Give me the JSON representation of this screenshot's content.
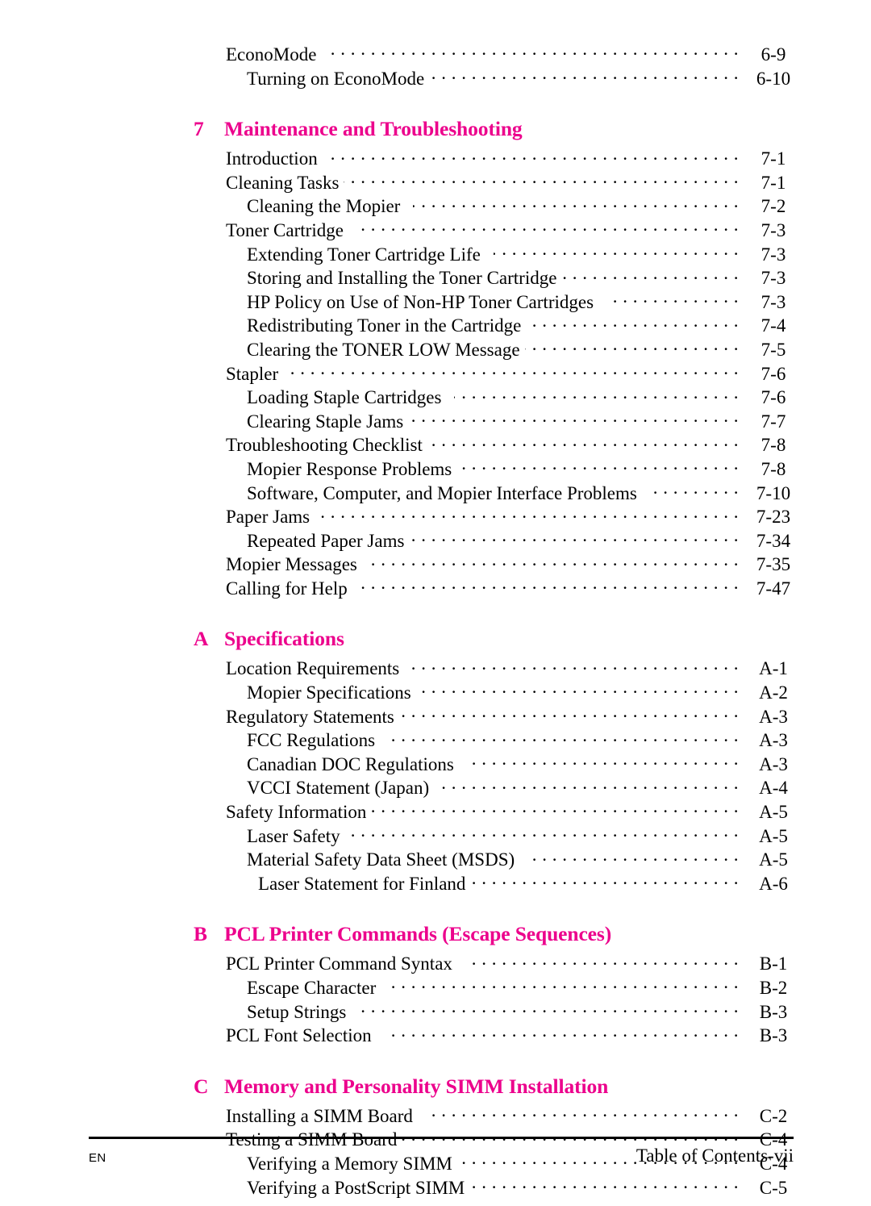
{
  "document": {
    "type": "table-of-contents",
    "accent_color": "#EC008C",
    "text_color": "#000000",
    "background_color": "#FFFFFF"
  },
  "blocks": [
    {
      "kind": "entry",
      "level": 1,
      "label": "EconoMode",
      "page": "6-9",
      "wide_gap": true
    },
    {
      "kind": "entry",
      "level": 2,
      "label": "Turning on EconoMode",
      "page": "6-10",
      "wide_gap": false
    },
    {
      "kind": "chapter",
      "number": "7",
      "title": "Maintenance and Troubleshooting"
    },
    {
      "kind": "entry",
      "level": 1,
      "label": "Introduction",
      "page": "7-1",
      "wide_gap": true
    },
    {
      "kind": "entry",
      "level": 1,
      "label": "Cleaning Tasks",
      "page": "7-1",
      "wide_gap": false
    },
    {
      "kind": "entry",
      "level": 2,
      "label": "Cleaning the Mopier",
      "page": "7-2",
      "wide_gap": true
    },
    {
      "kind": "entry",
      "level": 1,
      "label": "Toner Cartridge",
      "page": "7-3",
      "wide_gap": true
    },
    {
      "kind": "entry",
      "level": 2,
      "label": "Extending Toner Cartridge Life",
      "page": "7-3",
      "wide_gap": true
    },
    {
      "kind": "entry",
      "level": 2,
      "label": "Storing and Installing the Toner Cartridge",
      "page": "7-3",
      "wide_gap": false
    },
    {
      "kind": "entry",
      "level": 2,
      "label": "HP Policy on Use of Non-HP Toner Cartridges",
      "page": "7-3",
      "wide_gap": true
    },
    {
      "kind": "entry",
      "level": 2,
      "label": "Redistributing Toner in the Cartridge",
      "page": "7-4",
      "wide_gap": false
    },
    {
      "kind": "entry",
      "level": 2,
      "label": "Clearing the TONER LOW Message",
      "page": "7-5",
      "wide_gap": false
    },
    {
      "kind": "entry",
      "level": 1,
      "label": "Stapler",
      "page": "7-6",
      "wide_gap": true
    },
    {
      "kind": "entry",
      "level": 2,
      "label": "Loading Staple Cartridges",
      "page": "7-6",
      "wide_gap": true
    },
    {
      "kind": "entry",
      "level": 2,
      "label": "Clearing Staple Jams",
      "page": "7-7",
      "wide_gap": false
    },
    {
      "kind": "entry",
      "level": 1,
      "label": "Troubleshooting Checklist",
      "page": "7-8",
      "wide_gap": false
    },
    {
      "kind": "entry",
      "level": 2,
      "label": "Mopier Response Problems",
      "page": "7-8",
      "wide_gap": false
    },
    {
      "kind": "entry",
      "level": 2,
      "label": "Software, Computer, and Mopier Interface Problems",
      "page": "7-10",
      "wide_gap": true
    },
    {
      "kind": "entry",
      "level": 1,
      "label": "Paper Jams",
      "page": "7-23",
      "wide_gap": false
    },
    {
      "kind": "entry",
      "level": 2,
      "label": "Repeated Paper Jams",
      "page": "7-34",
      "wide_gap": false
    },
    {
      "kind": "entry",
      "level": 1,
      "label": "Mopier Messages",
      "page": "7-35",
      "wide_gap": true
    },
    {
      "kind": "entry",
      "level": 1,
      "label": "Calling for Help",
      "page": "7-47",
      "wide_gap": true
    },
    {
      "kind": "chapter",
      "number": "A",
      "title": "Specifications"
    },
    {
      "kind": "entry",
      "level": 1,
      "label": "Location Requirements",
      "page": "A-1",
      "wide_gap": true
    },
    {
      "kind": "entry",
      "level": 2,
      "label": "Mopier Specifications",
      "page": "A-2",
      "wide_gap": false
    },
    {
      "kind": "entry",
      "level": 1,
      "label": "Regulatory Statements",
      "page": "A-3",
      "wide_gap": false
    },
    {
      "kind": "entry",
      "level": 2,
      "label": "FCC Regulations",
      "page": "A-3",
      "wide_gap": true
    },
    {
      "kind": "entry",
      "level": 2,
      "label": "Canadian DOC Regulations",
      "page": "A-3",
      "wide_gap": true
    },
    {
      "kind": "entry",
      "level": 2,
      "label": "VCCI Statement (Japan)",
      "page": "A-4",
      "wide_gap": true
    },
    {
      "kind": "entry",
      "level": 1,
      "label": "Safety Information",
      "page": "A-5",
      "wide_gap": false
    },
    {
      "kind": "entry",
      "level": 2,
      "label": "Laser Safety",
      "page": "A-5",
      "wide_gap": false
    },
    {
      "kind": "entry",
      "level": 2,
      "label": "Material Safety Data Sheet (MSDS)",
      "page": "A-5",
      "wide_gap": true
    },
    {
      "kind": "entry",
      "level": 3,
      "label": "Laser Statement for Finland",
      "page": "A-6",
      "wide_gap": false
    },
    {
      "kind": "chapter",
      "number": "B",
      "title": "PCL Printer Commands (Escape Sequences)"
    },
    {
      "kind": "entry",
      "level": 1,
      "label": "PCL Printer Command Syntax",
      "page": "B-1",
      "wide_gap": true
    },
    {
      "kind": "entry",
      "level": 2,
      "label": "Escape Character",
      "page": "B-2",
      "wide_gap": true
    },
    {
      "kind": "entry",
      "level": 2,
      "label": "Setup Strings",
      "page": "B-3",
      "wide_gap": true
    },
    {
      "kind": "entry",
      "level": 1,
      "label": "PCL Font Selection",
      "page": "B-3",
      "wide_gap": true
    },
    {
      "kind": "chapter",
      "number": "C",
      "title": "Memory and Personality SIMM Installation"
    },
    {
      "kind": "entry",
      "level": 1,
      "label": "Installing a SIMM Board",
      "page": "C-2",
      "wide_gap": true
    },
    {
      "kind": "entry",
      "level": 1,
      "label": "Testing a SIMM Board",
      "page": "C-4",
      "wide_gap": false
    },
    {
      "kind": "entry",
      "level": 2,
      "label": "Verifying a Memory SIMM",
      "page": "C-4",
      "wide_gap": false
    },
    {
      "kind": "entry",
      "level": 2,
      "label": "Verifying a PostScript SIMM",
      "page": "C-5",
      "wide_gap": false
    }
  ],
  "footer": {
    "language": "EN",
    "folio": "Table of Contents-vii"
  }
}
